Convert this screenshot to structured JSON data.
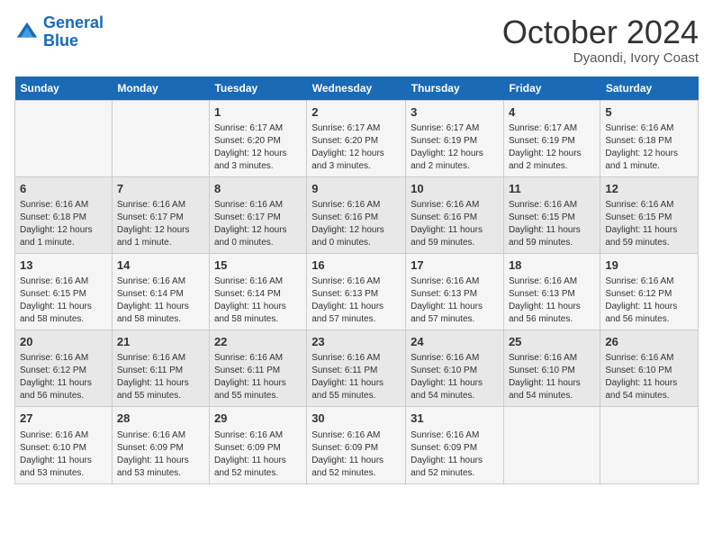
{
  "header": {
    "logo_line1": "General",
    "logo_line2": "Blue",
    "month": "October 2024",
    "location": "Dyaondi, Ivory Coast"
  },
  "weekdays": [
    "Sunday",
    "Monday",
    "Tuesday",
    "Wednesday",
    "Thursday",
    "Friday",
    "Saturday"
  ],
  "weeks": [
    [
      {
        "day": "",
        "detail": ""
      },
      {
        "day": "",
        "detail": ""
      },
      {
        "day": "1",
        "detail": "Sunrise: 6:17 AM\nSunset: 6:20 PM\nDaylight: 12 hours and 3 minutes."
      },
      {
        "day": "2",
        "detail": "Sunrise: 6:17 AM\nSunset: 6:20 PM\nDaylight: 12 hours and 3 minutes."
      },
      {
        "day": "3",
        "detail": "Sunrise: 6:17 AM\nSunset: 6:19 PM\nDaylight: 12 hours and 2 minutes."
      },
      {
        "day": "4",
        "detail": "Sunrise: 6:17 AM\nSunset: 6:19 PM\nDaylight: 12 hours and 2 minutes."
      },
      {
        "day": "5",
        "detail": "Sunrise: 6:16 AM\nSunset: 6:18 PM\nDaylight: 12 hours and 1 minute."
      }
    ],
    [
      {
        "day": "6",
        "detail": "Sunrise: 6:16 AM\nSunset: 6:18 PM\nDaylight: 12 hours and 1 minute."
      },
      {
        "day": "7",
        "detail": "Sunrise: 6:16 AM\nSunset: 6:17 PM\nDaylight: 12 hours and 1 minute."
      },
      {
        "day": "8",
        "detail": "Sunrise: 6:16 AM\nSunset: 6:17 PM\nDaylight: 12 hours and 0 minutes."
      },
      {
        "day": "9",
        "detail": "Sunrise: 6:16 AM\nSunset: 6:16 PM\nDaylight: 12 hours and 0 minutes."
      },
      {
        "day": "10",
        "detail": "Sunrise: 6:16 AM\nSunset: 6:16 PM\nDaylight: 11 hours and 59 minutes."
      },
      {
        "day": "11",
        "detail": "Sunrise: 6:16 AM\nSunset: 6:15 PM\nDaylight: 11 hours and 59 minutes."
      },
      {
        "day": "12",
        "detail": "Sunrise: 6:16 AM\nSunset: 6:15 PM\nDaylight: 11 hours and 59 minutes."
      }
    ],
    [
      {
        "day": "13",
        "detail": "Sunrise: 6:16 AM\nSunset: 6:15 PM\nDaylight: 11 hours and 58 minutes."
      },
      {
        "day": "14",
        "detail": "Sunrise: 6:16 AM\nSunset: 6:14 PM\nDaylight: 11 hours and 58 minutes."
      },
      {
        "day": "15",
        "detail": "Sunrise: 6:16 AM\nSunset: 6:14 PM\nDaylight: 11 hours and 58 minutes."
      },
      {
        "day": "16",
        "detail": "Sunrise: 6:16 AM\nSunset: 6:13 PM\nDaylight: 11 hours and 57 minutes."
      },
      {
        "day": "17",
        "detail": "Sunrise: 6:16 AM\nSunset: 6:13 PM\nDaylight: 11 hours and 57 minutes."
      },
      {
        "day": "18",
        "detail": "Sunrise: 6:16 AM\nSunset: 6:13 PM\nDaylight: 11 hours and 56 minutes."
      },
      {
        "day": "19",
        "detail": "Sunrise: 6:16 AM\nSunset: 6:12 PM\nDaylight: 11 hours and 56 minutes."
      }
    ],
    [
      {
        "day": "20",
        "detail": "Sunrise: 6:16 AM\nSunset: 6:12 PM\nDaylight: 11 hours and 56 minutes."
      },
      {
        "day": "21",
        "detail": "Sunrise: 6:16 AM\nSunset: 6:11 PM\nDaylight: 11 hours and 55 minutes."
      },
      {
        "day": "22",
        "detail": "Sunrise: 6:16 AM\nSunset: 6:11 PM\nDaylight: 11 hours and 55 minutes."
      },
      {
        "day": "23",
        "detail": "Sunrise: 6:16 AM\nSunset: 6:11 PM\nDaylight: 11 hours and 55 minutes."
      },
      {
        "day": "24",
        "detail": "Sunrise: 6:16 AM\nSunset: 6:10 PM\nDaylight: 11 hours and 54 minutes."
      },
      {
        "day": "25",
        "detail": "Sunrise: 6:16 AM\nSunset: 6:10 PM\nDaylight: 11 hours and 54 minutes."
      },
      {
        "day": "26",
        "detail": "Sunrise: 6:16 AM\nSunset: 6:10 PM\nDaylight: 11 hours and 54 minutes."
      }
    ],
    [
      {
        "day": "27",
        "detail": "Sunrise: 6:16 AM\nSunset: 6:10 PM\nDaylight: 11 hours and 53 minutes."
      },
      {
        "day": "28",
        "detail": "Sunrise: 6:16 AM\nSunset: 6:09 PM\nDaylight: 11 hours and 53 minutes."
      },
      {
        "day": "29",
        "detail": "Sunrise: 6:16 AM\nSunset: 6:09 PM\nDaylight: 11 hours and 52 minutes."
      },
      {
        "day": "30",
        "detail": "Sunrise: 6:16 AM\nSunset: 6:09 PM\nDaylight: 11 hours and 52 minutes."
      },
      {
        "day": "31",
        "detail": "Sunrise: 6:16 AM\nSunset: 6:09 PM\nDaylight: 11 hours and 52 minutes."
      },
      {
        "day": "",
        "detail": ""
      },
      {
        "day": "",
        "detail": ""
      }
    ]
  ]
}
